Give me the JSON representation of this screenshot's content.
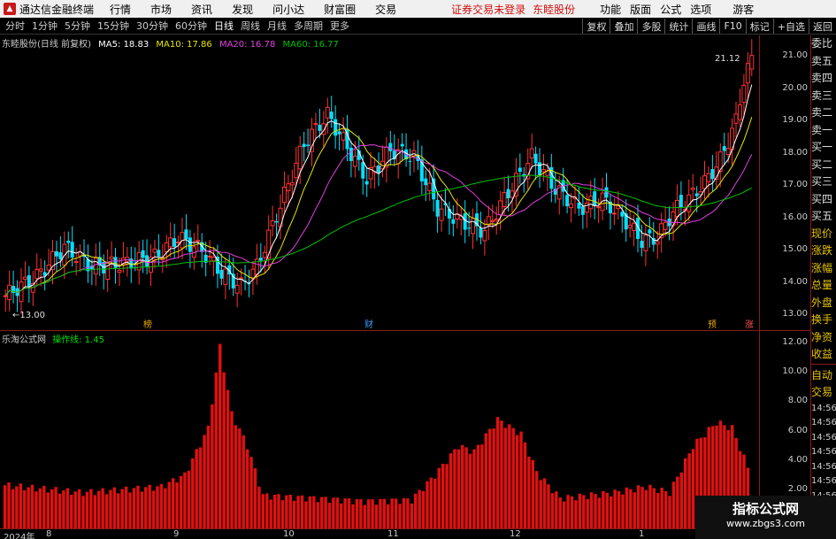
{
  "menubar": {
    "app_title": "通达信金融终端",
    "items": [
      "行情",
      "市场",
      "资讯",
      "发现",
      "问小达",
      "财富圈",
      "交易"
    ],
    "login_status": "证券交易未登录",
    "stock_name": "东睦股份",
    "right_items": [
      "功能",
      "版面",
      "公式",
      "选项"
    ],
    "guest": "游客"
  },
  "toolbar": {
    "periods": [
      "分时",
      "1分钟",
      "5分钟",
      "15分钟",
      "30分钟",
      "60分钟",
      "日线",
      "周线",
      "月线",
      "多周期",
      "更多"
    ],
    "active_period": "日线",
    "buttons": [
      "复权",
      "叠加",
      "多股",
      "统计",
      "画线",
      "F10",
      "标记",
      "+自选",
      "返回"
    ]
  },
  "chart_header": {
    "title": "东睦股份(日线 前复权)",
    "ma5": "MA5: 18.83",
    "ma10": "MA10: 17.86",
    "ma20": "MA20: 16.78",
    "ma60": "MA60: 16.77",
    "high_label": "21.12",
    "low_label": "13.00",
    "markers": [
      "榜",
      "财",
      "预",
      "涨"
    ]
  },
  "indicator_header": {
    "name": "乐淘公式网",
    "line_label": "操作线: 1.45"
  },
  "price_axis": [
    "21.00",
    "20.00",
    "19.00",
    "18.00",
    "17.00",
    "16.00",
    "15.00",
    "14.00",
    "13.00"
  ],
  "indicator_axis": [
    "12.00",
    "10.00",
    "8.00",
    "6.00",
    "4.00",
    "2.00"
  ],
  "date_axis": [
    "2024年",
    "8",
    "9",
    "10",
    "11",
    "12",
    "1"
  ],
  "side_panel": {
    "items": [
      "委比",
      "卖五",
      "卖四",
      "卖三",
      "卖二",
      "卖一",
      "买一",
      "买二",
      "买三",
      "买四",
      "买五",
      "现价",
      "涨跌",
      "涨幅",
      "总量",
      "外盘",
      "换手",
      "净资",
      "收益"
    ],
    "trade_items": [
      "自动",
      "交易"
    ],
    "times": [
      "14:56",
      "14:56",
      "14:56",
      "14:56",
      "14:56",
      "14:56",
      "14:56",
      "14:56"
    ]
  },
  "watermark": {
    "title": "指标公式网",
    "url": "www.zbgs3.com"
  },
  "colors": {
    "up": "#ff3232",
    "down": "#00e0ff",
    "ma5": "#ffffff",
    "ma10": "#e6e600",
    "ma20": "#e040e0",
    "ma60": "#00c000",
    "bar": "#e01010"
  }
}
